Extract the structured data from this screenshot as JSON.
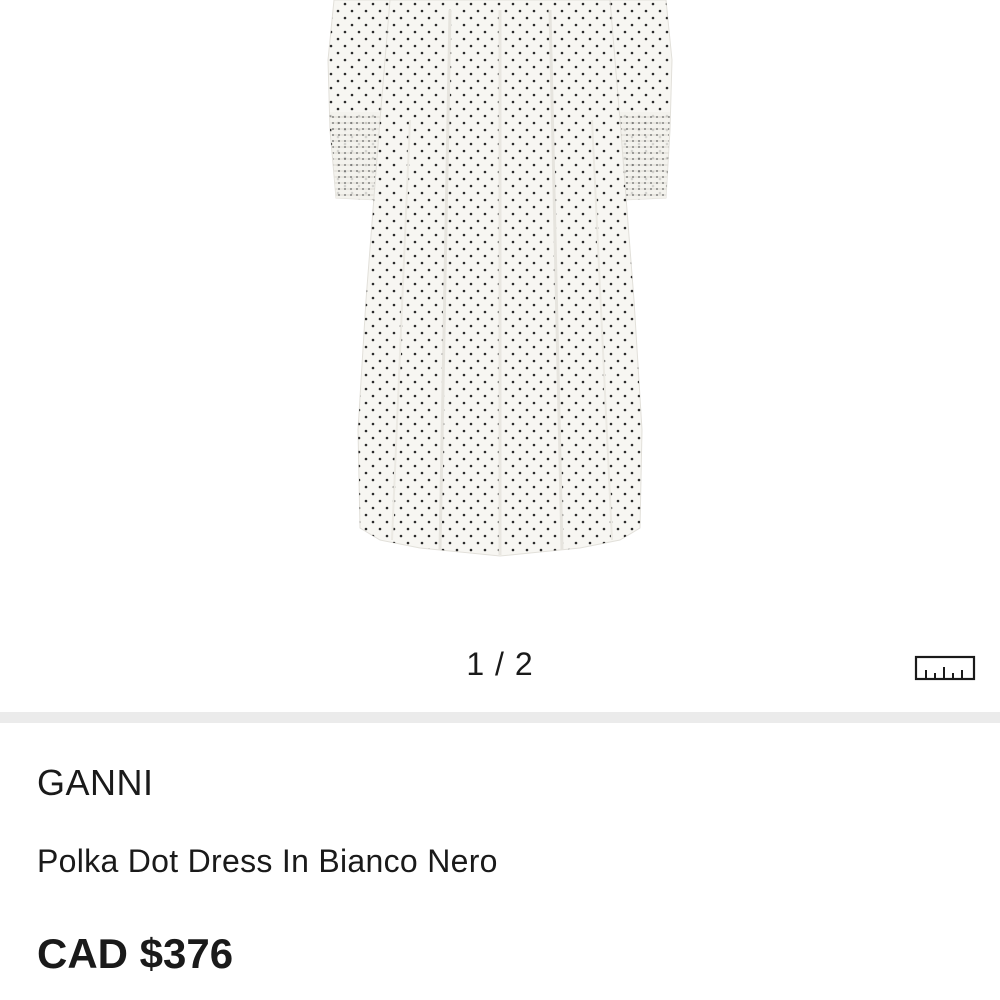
{
  "gallery": {
    "image_alt": "Polka Dot Dress In Bianco Nero",
    "pager": "1 / 2",
    "size_guide_icon": "ruler-icon",
    "current_image": 1,
    "total_images": 2
  },
  "product": {
    "brand": "GANNI",
    "name": "Polka Dot Dress In Bianco Nero",
    "price": "CAD $376"
  },
  "colors": {
    "background": "#ffffff",
    "divider": "#ebebeb",
    "text": "#1a1a1a",
    "dress": "#f7f6f2",
    "dots": "#2b2b2b"
  }
}
